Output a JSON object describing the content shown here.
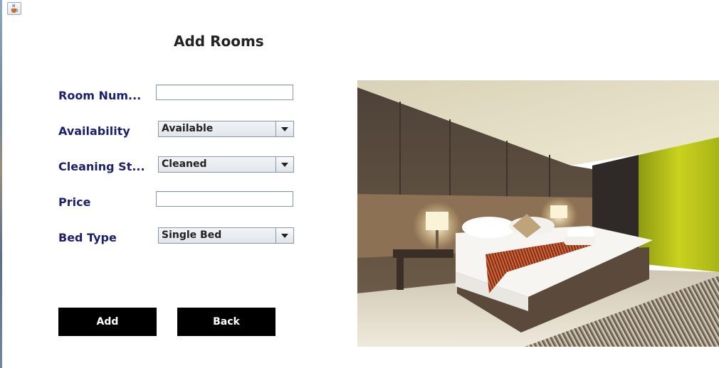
{
  "window": {
    "icon": "java-cup-icon"
  },
  "title": "Add Rooms",
  "form": {
    "room_number": {
      "label": "Room Num...",
      "value": ""
    },
    "availability": {
      "label": "Availability",
      "selected": "Available"
    },
    "cleaning_status": {
      "label": "Cleaning St...",
      "selected": "Cleaned"
    },
    "price": {
      "label": "Price",
      "value": ""
    },
    "bed_type": {
      "label": "Bed Type",
      "selected": "Single Bed"
    }
  },
  "buttons": {
    "add": "Add",
    "back": "Back"
  },
  "image": {
    "subject": "hotel-bedroom-photo"
  }
}
